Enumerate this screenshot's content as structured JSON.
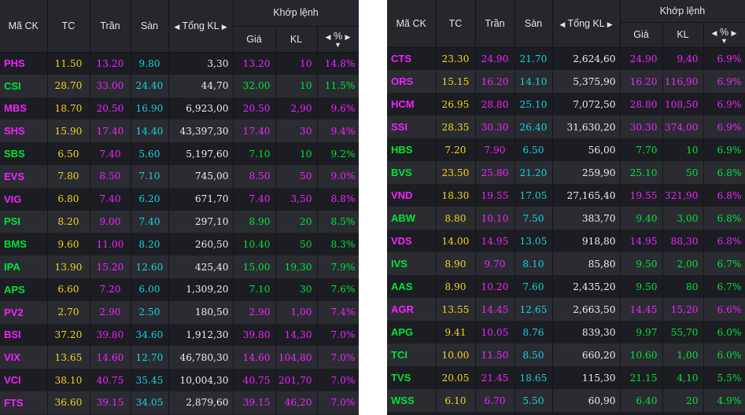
{
  "colors": {
    "ceiling": "#f222ff",
    "up": "#00e436",
    "reference": "#f6d21a",
    "floor": "#17d2dc",
    "header_bg": "#25272d",
    "row_dark": "#1b1d22",
    "row_light": "#2a2c32"
  },
  "icons": {
    "sort_left": "triangle-left-icon",
    "sort_right": "triangle-right-icon",
    "sort_down": "triangle-down-icon"
  },
  "header": {
    "symbol": "Mã CK",
    "ref": "TC",
    "ceiling": "Trần",
    "floor": "Sàn",
    "total_volume": "Tổng KL",
    "matched_group": "Khớp lệnh",
    "price": "Giá",
    "volume": "KL",
    "pct": "%"
  },
  "left_rows": [
    {
      "sym": "PHS",
      "tc": "11.50",
      "tran": "13.20",
      "san": "9.80",
      "tong": "3,30",
      "gia": "13.20",
      "kl": "10",
      "pct": "14.8%",
      "status": "ceiling"
    },
    {
      "sym": "CSI",
      "tc": "28.70",
      "tran": "33.00",
      "san": "24.40",
      "tong": "44,70",
      "gia": "32.00",
      "kl": "10",
      "pct": "11.5%",
      "status": "up"
    },
    {
      "sym": "MBS",
      "tc": "18.70",
      "tran": "20.50",
      "san": "16.90",
      "tong": "6,923,00",
      "gia": "20.50",
      "kl": "2,90",
      "pct": "9.6%",
      "status": "ceiling"
    },
    {
      "sym": "SHS",
      "tc": "15.90",
      "tran": "17.40",
      "san": "14.40",
      "tong": "43,397,30",
      "gia": "17.40",
      "kl": "30",
      "pct": "9.4%",
      "status": "ceiling"
    },
    {
      "sym": "SBS",
      "tc": "6.50",
      "tran": "7.40",
      "san": "5.60",
      "tong": "5,197,60",
      "gia": "7.10",
      "kl": "10",
      "pct": "9.2%",
      "status": "up"
    },
    {
      "sym": "EVS",
      "tc": "7.80",
      "tran": "8.50",
      "san": "7.10",
      "tong": "745,00",
      "gia": "8.50",
      "kl": "50",
      "pct": "9.0%",
      "status": "ceiling"
    },
    {
      "sym": "VIG",
      "tc": "6.80",
      "tran": "7.40",
      "san": "6.20",
      "tong": "671,70",
      "gia": "7.40",
      "kl": "3,50",
      "pct": "8.8%",
      "status": "ceiling"
    },
    {
      "sym": "PSI",
      "tc": "8.20",
      "tran": "9.00",
      "san": "7.40",
      "tong": "297,10",
      "gia": "8.90",
      "kl": "20",
      "pct": "8.5%",
      "status": "up"
    },
    {
      "sym": "BMS",
      "tc": "9.60",
      "tran": "11.00",
      "san": "8.20",
      "tong": "260,50",
      "gia": "10.40",
      "kl": "50",
      "pct": "8.3%",
      "status": "up"
    },
    {
      "sym": "IPA",
      "tc": "13.90",
      "tran": "15.20",
      "san": "12.60",
      "tong": "425,40",
      "gia": "15.00",
      "kl": "19,30",
      "pct": "7.9%",
      "status": "up"
    },
    {
      "sym": "APS",
      "tc": "6.60",
      "tran": "7.20",
      "san": "6.00",
      "tong": "1,309,20",
      "gia": "7.10",
      "kl": "30",
      "pct": "7.6%",
      "status": "up"
    },
    {
      "sym": "PV2",
      "tc": "2.70",
      "tran": "2.90",
      "san": "2.50",
      "tong": "180,50",
      "gia": "2.90",
      "kl": "1,00",
      "pct": "7.4%",
      "status": "ceiling"
    },
    {
      "sym": "BSI",
      "tc": "37.20",
      "tran": "39.80",
      "san": "34.60",
      "tong": "1,912,30",
      "gia": "39.80",
      "kl": "14,30",
      "pct": "7.0%",
      "status": "ceiling"
    },
    {
      "sym": "VIX",
      "tc": "13.65",
      "tran": "14.60",
      "san": "12.70",
      "tong": "46,780,30",
      "gia": "14.60",
      "kl": "104,80",
      "pct": "7.0%",
      "status": "ceiling"
    },
    {
      "sym": "VCI",
      "tc": "38.10",
      "tran": "40.75",
      "san": "35.45",
      "tong": "10,004,30",
      "gia": "40.75",
      "kl": "201,70",
      "pct": "7.0%",
      "status": "ceiling"
    },
    {
      "sym": "FTS",
      "tc": "36.60",
      "tran": "39.15",
      "san": "34.05",
      "tong": "2,879,60",
      "gia": "39.15",
      "kl": "46,20",
      "pct": "7.0%",
      "status": "ceiling"
    }
  ],
  "right_rows": [
    {
      "sym": "CTS",
      "tc": "23.30",
      "tran": "24.90",
      "san": "21.70",
      "tong": "2,624,60",
      "gia": "24.90",
      "kl": "9,40",
      "pct": "6.9%",
      "status": "ceiling"
    },
    {
      "sym": "ORS",
      "tc": "15.15",
      "tran": "16.20",
      "san": "14.10",
      "tong": "5,375,90",
      "gia": "16.20",
      "kl": "116,90",
      "pct": "6.9%",
      "status": "ceiling"
    },
    {
      "sym": "HCM",
      "tc": "26.95",
      "tran": "28.80",
      "san": "25.10",
      "tong": "7,072,50",
      "gia": "28.80",
      "kl": "108,50",
      "pct": "6.9%",
      "status": "ceiling"
    },
    {
      "sym": "SSI",
      "tc": "28.35",
      "tran": "30.30",
      "san": "26.40",
      "tong": "31,630,20",
      "gia": "30.30",
      "kl": "374,00",
      "pct": "6.9%",
      "status": "ceiling"
    },
    {
      "sym": "HBS",
      "tc": "7.20",
      "tran": "7.90",
      "san": "6.50",
      "tong": "56,00",
      "gia": "7.70",
      "kl": "10",
      "pct": "6.9%",
      "status": "up"
    },
    {
      "sym": "BVS",
      "tc": "23.50",
      "tran": "25.80",
      "san": "21.20",
      "tong": "259,90",
      "gia": "25.10",
      "kl": "50",
      "pct": "6.8%",
      "status": "up"
    },
    {
      "sym": "VND",
      "tc": "18.30",
      "tran": "19.55",
      "san": "17.05",
      "tong": "27,165,40",
      "gia": "19.55",
      "kl": "321,90",
      "pct": "6.8%",
      "status": "ceiling"
    },
    {
      "sym": "ABW",
      "tc": "8.80",
      "tran": "10.10",
      "san": "7.50",
      "tong": "383,70",
      "gia": "9.40",
      "kl": "3,00",
      "pct": "6.8%",
      "status": "up"
    },
    {
      "sym": "VDS",
      "tc": "14.00",
      "tran": "14.95",
      "san": "13.05",
      "tong": "918,80",
      "gia": "14.95",
      "kl": "88,30",
      "pct": "6.8%",
      "status": "ceiling"
    },
    {
      "sym": "IVS",
      "tc": "8.90",
      "tran": "9.70",
      "san": "8.10",
      "tong": "85,80",
      "gia": "9.50",
      "kl": "2,00",
      "pct": "6.7%",
      "status": "up"
    },
    {
      "sym": "AAS",
      "tc": "8.90",
      "tran": "10.20",
      "san": "7.60",
      "tong": "2,435,20",
      "gia": "9.50",
      "kl": "80",
      "pct": "6.7%",
      "status": "up"
    },
    {
      "sym": "AGR",
      "tc": "13.55",
      "tran": "14.45",
      "san": "12.65",
      "tong": "2,663,50",
      "gia": "14.45",
      "kl": "15,20",
      "pct": "6.6%",
      "status": "ceiling"
    },
    {
      "sym": "APG",
      "tc": "9.41",
      "tran": "10.05",
      "san": "8.76",
      "tong": "839,30",
      "gia": "9.97",
      "kl": "55,70",
      "pct": "6.0%",
      "status": "up"
    },
    {
      "sym": "TCI",
      "tc": "10.00",
      "tran": "11.50",
      "san": "8.50",
      "tong": "660,20",
      "gia": "10.60",
      "kl": "1,00",
      "pct": "6.0%",
      "status": "up"
    },
    {
      "sym": "TVS",
      "tc": "20.05",
      "tran": "21.45",
      "san": "18.65",
      "tong": "115,30",
      "gia": "21.15",
      "kl": "4,10",
      "pct": "5.5%",
      "status": "up"
    },
    {
      "sym": "WSS",
      "tc": "6.10",
      "tran": "6.70",
      "san": "5.50",
      "tong": "60,90",
      "gia": "6.40",
      "kl": "20",
      "pct": "4.9%",
      "status": "up"
    }
  ]
}
